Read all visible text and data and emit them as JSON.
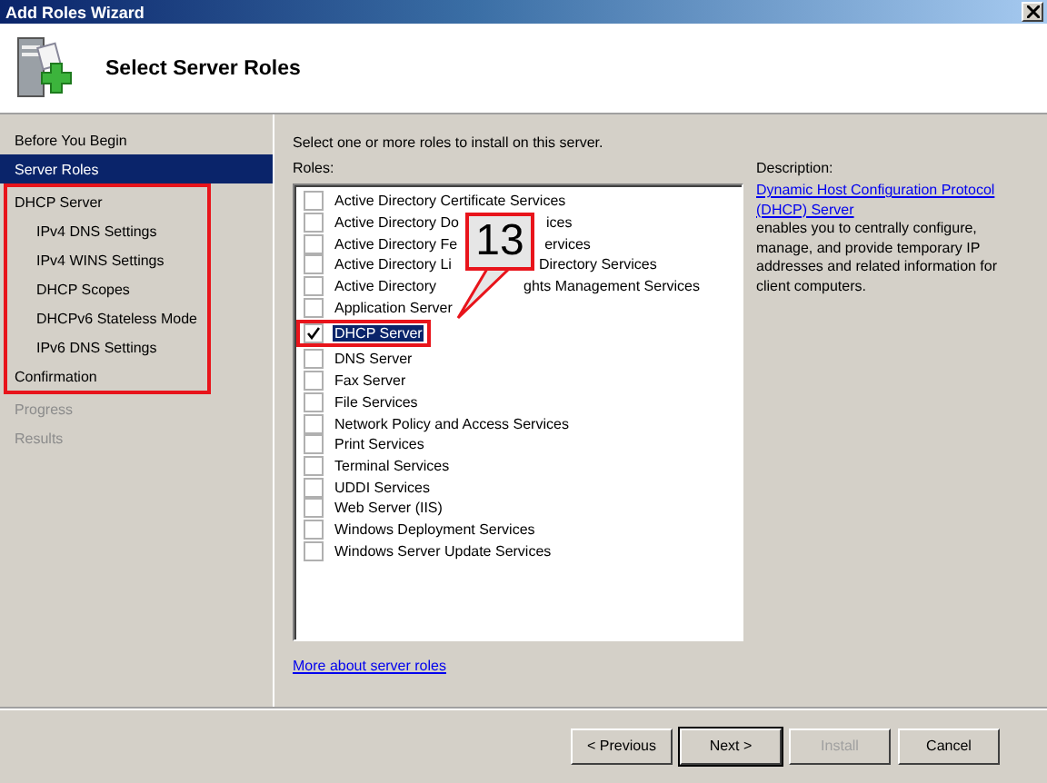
{
  "window": {
    "title": "Add Roles Wizard"
  },
  "header": {
    "title": "Select Server Roles"
  },
  "sidebar": {
    "items": [
      {
        "label": "Before You Begin",
        "selected": false,
        "disabled": false,
        "highlighted": false
      },
      {
        "label": "Server Roles",
        "selected": true,
        "disabled": false,
        "highlighted": false
      },
      {
        "label": "DHCP Server",
        "selected": false,
        "disabled": false,
        "highlighted": true,
        "children": [
          {
            "label": "IPv4 DNS Settings",
            "selected": false,
            "disabled": false,
            "highlighted": true
          },
          {
            "label": "IPv4 WINS Settings",
            "selected": false,
            "disabled": false,
            "highlighted": true
          },
          {
            "label": "DHCP Scopes",
            "selected": false,
            "disabled": false,
            "highlighted": true
          },
          {
            "label": "DHCPv6 Stateless Mode",
            "selected": false,
            "disabled": false,
            "highlighted": true
          },
          {
            "label": "IPv6 DNS Settings",
            "selected": false,
            "disabled": false,
            "highlighted": true
          }
        ]
      },
      {
        "label": "Confirmation",
        "selected": false,
        "disabled": false,
        "highlighted": true
      },
      {
        "label": "Progress",
        "selected": false,
        "disabled": true,
        "highlighted": false
      },
      {
        "label": "Results",
        "selected": false,
        "disabled": true,
        "highlighted": false
      }
    ]
  },
  "instructions": "Select one or more roles to install on this server.",
  "roles_label": "Roles:",
  "roles": [
    {
      "label": "Active Directory Certificate Services",
      "checked": false,
      "highlighted": false
    },
    {
      "label": "Active Directory Do",
      "label_after": "ices",
      "checked": false,
      "highlighted": false
    },
    {
      "label": "Active Directory Fe",
      "label_after": "ervices",
      "checked": false,
      "highlighted": false
    },
    {
      "label": "Active Directory Li",
      "label_after": "Directory Services",
      "checked": false,
      "highlighted": false
    },
    {
      "label": "Active Directory",
      "label_after": "ghts Management Services",
      "checked": false,
      "highlighted": false
    },
    {
      "label": "Application Server",
      "checked": false,
      "highlighted": false
    },
    {
      "label": "DHCP Server",
      "checked": true,
      "highlighted": true
    },
    {
      "label": "DNS Server",
      "checked": false,
      "highlighted": false
    },
    {
      "label": "Fax Server",
      "checked": false,
      "highlighted": false
    },
    {
      "label": "File Services",
      "checked": false,
      "highlighted": false
    },
    {
      "label": "Network Policy and Access Services",
      "checked": false,
      "highlighted": false
    },
    {
      "label": "Print Services",
      "checked": false,
      "highlighted": false
    },
    {
      "label": "Terminal Services",
      "checked": false,
      "highlighted": false
    },
    {
      "label": "UDDI Services",
      "checked": false,
      "highlighted": false
    },
    {
      "label": "Web Server (IIS)",
      "checked": false,
      "highlighted": false
    },
    {
      "label": "Windows Deployment Services",
      "checked": false,
      "highlighted": false
    },
    {
      "label": "Windows Server Update Services",
      "checked": false,
      "highlighted": false
    }
  ],
  "callout": {
    "text": "13"
  },
  "more_link": "More about server roles",
  "description": {
    "label": "Description:",
    "link": "Dynamic Host Configuration Protocol (DHCP) Server",
    "text": " enables you to centrally configure, manage, and provide temporary IP addresses and related information for client computers."
  },
  "buttons": [
    {
      "label": "< Previous",
      "disabled": false,
      "default": false
    },
    {
      "label": "Next >",
      "disabled": false,
      "default": true
    },
    {
      "label": "Install",
      "disabled": true,
      "default": false
    },
    {
      "label": "Cancel",
      "disabled": false,
      "default": false
    }
  ]
}
